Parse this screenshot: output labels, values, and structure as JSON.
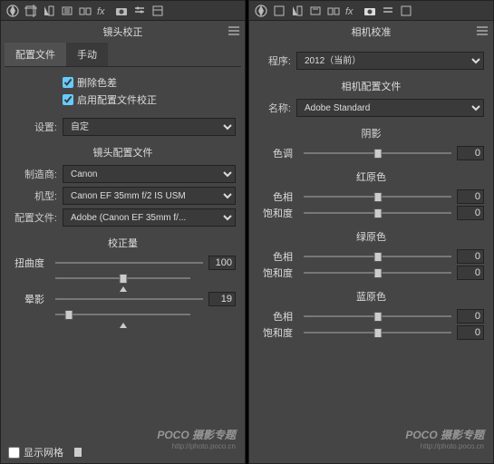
{
  "left": {
    "title": "镜头校正",
    "tabs": [
      "配置文件",
      "手动"
    ],
    "chk1": "删除色差",
    "chk2": "启用配置文件校正",
    "settings_lbl": "设置:",
    "settings_val": "自定",
    "section1": "镜头配置文件",
    "maker_lbl": "制造商:",
    "maker_val": "Canon",
    "model_lbl": "机型:",
    "model_val": "Canon EF 35mm f/2 IS USM",
    "profile_lbl": "配置文件:",
    "profile_val": "Adobe (Canon EF 35mm f/...",
    "section2": "校正量",
    "distort_lbl": "扭曲度",
    "distort_val": "100",
    "vignette_lbl": "晕影",
    "vignette_val": "19",
    "show_grid": "显示网格"
  },
  "right": {
    "title": "相机校准",
    "program_lbl": "程序:",
    "program_val": "2012（当前）",
    "section1": "相机配置文件",
    "name_lbl": "名称:",
    "name_val": "Adobe Standard",
    "shadow": "阴影",
    "tint_lbl": "色调",
    "hue_lbl": "色相",
    "sat_lbl": "饱和度",
    "red": "红原色",
    "green": "绿原色",
    "blue": "蓝原色",
    "zero": "0"
  },
  "wm": {
    "brand": "POCO",
    "sub": " 摄影专题",
    "url": "http://photo.poco.cn"
  }
}
